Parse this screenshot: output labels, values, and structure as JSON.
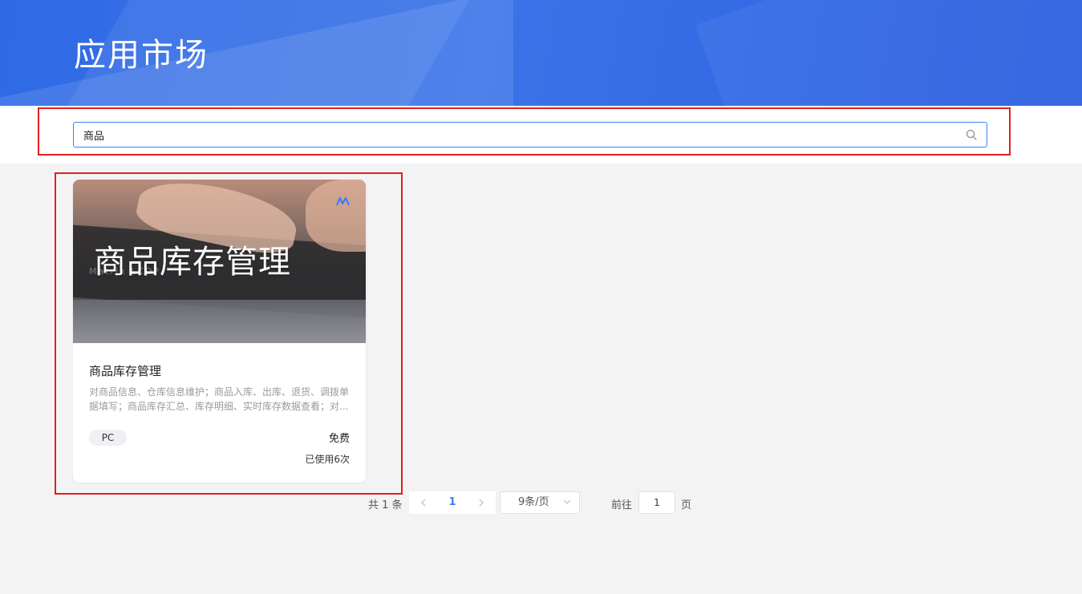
{
  "header": {
    "title": "应用市场"
  },
  "search": {
    "value": "商品",
    "icon": "search-icon"
  },
  "apps": [
    {
      "image_title": "商品库存管理",
      "image_subtitle": "Matrix LCDP",
      "name": "商品库存管理",
      "description": "对商品信息、仓库信息维护；商品入库、出库、退货、调拨单据填写；商品库存汇总、库存明细、实时库存数据查看；对...",
      "platform_tag": "PC",
      "price": "免费",
      "usage": "已使用6次"
    }
  ],
  "pagination": {
    "total": "共 1 条",
    "current_page": "1",
    "page_size": "9条/页",
    "goto_label": "前往",
    "goto_value": "1",
    "goto_suffix": "页"
  },
  "colors": {
    "header_blue": "#2f6ae6",
    "accent": "#3b7cff",
    "highlight_outline": "#e02020"
  }
}
